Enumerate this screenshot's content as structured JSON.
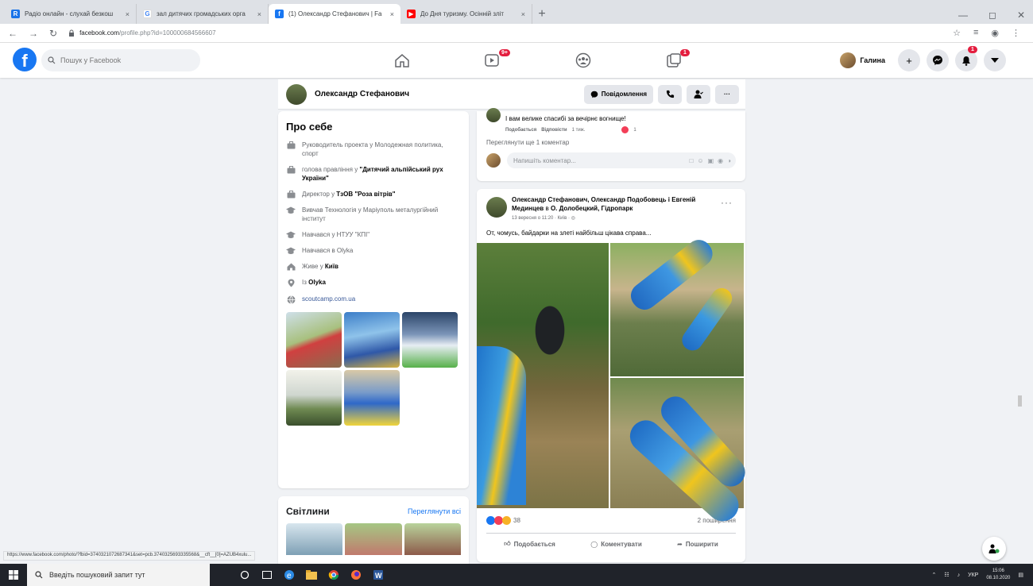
{
  "browser": {
    "tabs": [
      {
        "title": "Радіо онлайн - слухай безкош",
        "icon_color": "#1a73e8",
        "icon_char": "R",
        "active": false
      },
      {
        "title": "зал дитячих громадських орга",
        "icon_color": "#ffffff",
        "icon_char": "G",
        "active": false
      },
      {
        "title": "(1) Олександр Стефанович | Fa",
        "icon_color": "#1877f2",
        "icon_char": "f",
        "active": true
      },
      {
        "title": "До Дня туризму. Осінній зліт",
        "icon_color": "#ff0000",
        "icon_char": "▶",
        "active": false
      }
    ],
    "tab_close": "×",
    "new_tab": "+",
    "url_host": "facebook.com",
    "url_rest": "/profile.php?id=100000684566607"
  },
  "facebook": {
    "logo": "f",
    "search_placeholder": "Пошук у Facebook",
    "nav_badges": {
      "watch": "9+",
      "gaming": "1"
    },
    "user_name": "Галина",
    "notif_badge": "1",
    "plus": "+"
  },
  "profile": {
    "name": "Олександр Стефанович",
    "message_button": "Повідомлення",
    "more": "···"
  },
  "about": {
    "title": "Про себе",
    "items": [
      {
        "icon": "briefcase-icon",
        "text": "Руководитель проекта у Молодежная политика, спорт"
      },
      {
        "icon": "briefcase-icon",
        "pre": "голова правління у ",
        "bold": "\"Дитячий альпійський рух України\""
      },
      {
        "icon": "briefcase-icon",
        "pre": "Директор у ",
        "bold": "ТзОВ \"Роза вітрів\""
      },
      {
        "icon": "graduation-cap-icon",
        "text": "Вивчав Технологія у Маріуполь металургійний інститут"
      },
      {
        "icon": "graduation-cap-icon",
        "text": "Навчався у НТУУ \"КПІ\""
      },
      {
        "icon": "graduation-cap-icon",
        "text": "Навчався в Olyka"
      },
      {
        "icon": "home-icon",
        "pre": "Живе у ",
        "bold": "Київ"
      },
      {
        "icon": "location-pin-icon",
        "pre": "Із ",
        "bold": "Olyka"
      },
      {
        "icon": "globe-icon",
        "link": "scoutcamp.com.ua"
      }
    ]
  },
  "photos": {
    "title": "Світлини",
    "see_all": "Переглянути всі"
  },
  "comments": {
    "reply_text": "І вам велике спасибі за вечірнє вогнище!",
    "like": "Подобається",
    "reply": "Відповісти",
    "time": "1 тиж.",
    "like_count": "1",
    "more_comments": "Переглянути ще 1 коментар",
    "write_placeholder": "Напишіть коментар..."
  },
  "post": {
    "authors": "Олександр Стефанович, Олександр Подобовець і Евгеній Мединцев",
    "location_pre": " в ",
    "location": "О. Долобецкий, Гідропарк",
    "date": "13 вересня о 11:20 · Київ ·",
    "text": "От, чомусь, байдарки на злеті найбільш цікава справа...",
    "reaction_count": "38",
    "shares": "2 поширення",
    "like_action": "Подобається",
    "comment_action": "Коментувати",
    "share_action": "Поширити",
    "more": "···"
  },
  "status_url": "https://www.facebook.com/photo/?fbid=3740321072687341&set=pcb.3740325693335568&__cft__[0]=AZUB4xulu...",
  "taskbar": {
    "search_placeholder": "Введіть пошуковий запит тут",
    "lang": "УКР",
    "time": "15:06",
    "date": "08.10.2020"
  }
}
